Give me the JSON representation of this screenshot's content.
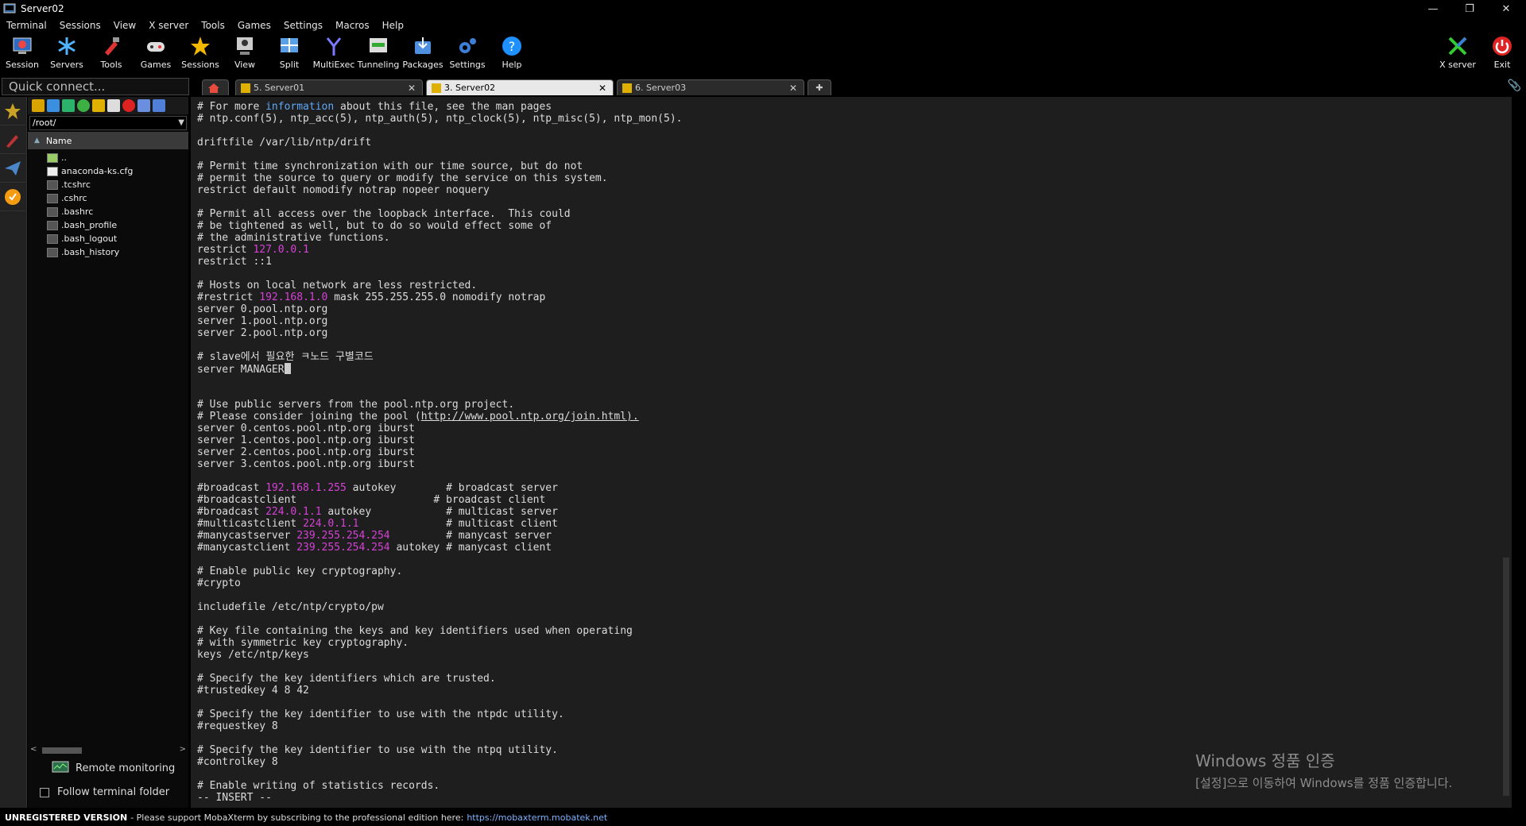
{
  "window": {
    "title": "Server02"
  },
  "menu": [
    "Terminal",
    "Sessions",
    "View",
    "X server",
    "Tools",
    "Games",
    "Settings",
    "Macros",
    "Help"
  ],
  "toolbar": {
    "session": "Session",
    "servers": "Servers",
    "tools": "Tools",
    "games": "Games",
    "sessions": "Sessions",
    "view": "View",
    "split": "Split",
    "multiexec": "MultiExec",
    "tunneling": "Tunneling",
    "packages": "Packages",
    "settings": "Settings",
    "help": "Help",
    "xserver": "X server",
    "exit": "Exit"
  },
  "quick_connect": {
    "placeholder": "Quick connect..."
  },
  "sidebar": {
    "path": "/root/",
    "column_header": "Name",
    "files": [
      "..",
      "anaconda-ks.cfg",
      ".tcshrc",
      ".cshrc",
      ".bashrc",
      ".bash_profile",
      ".bash_logout",
      ".bash_history"
    ],
    "remote_monitoring": "Remote monitoring",
    "follow_terminal_folder": "Follow terminal folder"
  },
  "tabs": [
    {
      "label": "5. Server01",
      "active": false
    },
    {
      "label": "3. Server02",
      "active": true
    },
    {
      "label": "6. Server03",
      "active": false
    }
  ],
  "terminal": {
    "lines": [
      [
        {
          "t": "# For more "
        },
        {
          "t": "information",
          "c": "bl"
        },
        {
          "t": " about this file, see the man pages"
        }
      ],
      [
        {
          "t": "# ntp.conf(5), ntp_acc(5), ntp_auth(5), ntp_clock(5), ntp_misc(5), ntp_mon(5)."
        }
      ],
      [
        {
          "t": ""
        }
      ],
      [
        {
          "t": "driftfile /var/lib/ntp/drift"
        }
      ],
      [
        {
          "t": ""
        }
      ],
      [
        {
          "t": "# Permit time synchronization with our time source, but do not"
        }
      ],
      [
        {
          "t": "# permit the source to query or modify the service on this system."
        }
      ],
      [
        {
          "t": "restrict default nomodify notrap nopeer noquery"
        }
      ],
      [
        {
          "t": ""
        }
      ],
      [
        {
          "t": "# Permit all access over the loopback interface.  This could"
        }
      ],
      [
        {
          "t": "# be tightened as well, but to do so would effect some of"
        }
      ],
      [
        {
          "t": "# the administrative functions."
        }
      ],
      [
        {
          "t": "restrict "
        },
        {
          "t": "127.0.0.1",
          "c": "mg"
        }
      ],
      [
        {
          "t": "restrict ::1"
        }
      ],
      [
        {
          "t": ""
        }
      ],
      [
        {
          "t": "# Hosts on local network are less restricted."
        }
      ],
      [
        {
          "t": "#restrict "
        },
        {
          "t": "192.168.1.0",
          "c": "mg"
        },
        {
          "t": " mask 255.255.255.0 nomodify notrap"
        }
      ],
      [
        {
          "t": "server 0.pool.ntp.org"
        }
      ],
      [
        {
          "t": "server 1.pool.ntp.org"
        }
      ],
      [
        {
          "t": "server 2.pool.ntp.org"
        }
      ],
      [
        {
          "t": ""
        }
      ],
      [
        {
          "t": "# slave에서 필요한 ㅋ노드 구별코드"
        }
      ],
      [
        {
          "t": "server MANAGER"
        },
        {
          "cursor": true
        }
      ],
      [
        {
          "t": ""
        }
      ],
      [
        {
          "t": ""
        }
      ],
      [
        {
          "t": "# Use public servers from the pool.ntp.org project."
        }
      ],
      [
        {
          "t": "# Please consider joining the pool ("
        },
        {
          "t": "http://www.pool.ntp.org/join.html).",
          "c": "ul"
        }
      ],
      [
        {
          "t": "server 0.centos.pool.ntp.org iburst"
        }
      ],
      [
        {
          "t": "server 1.centos.pool.ntp.org iburst"
        }
      ],
      [
        {
          "t": "server 2.centos.pool.ntp.org iburst"
        }
      ],
      [
        {
          "t": "server 3.centos.pool.ntp.org iburst"
        }
      ],
      [
        {
          "t": ""
        }
      ],
      [
        {
          "t": "#broadcast "
        },
        {
          "t": "192.168.1.255",
          "c": "mg"
        },
        {
          "t": " autokey        # broadcast server"
        }
      ],
      [
        {
          "t": "#broadcastclient                      # broadcast client"
        }
      ],
      [
        {
          "t": "#broadcast "
        },
        {
          "t": "224.0.1.1",
          "c": "mg"
        },
        {
          "t": " autokey            # multicast server"
        }
      ],
      [
        {
          "t": "#multicastclient "
        },
        {
          "t": "224.0.1.1",
          "c": "mg"
        },
        {
          "t": "              # multicast client"
        }
      ],
      [
        {
          "t": "#manycastserver "
        },
        {
          "t": "239.255.254.254",
          "c": "mg"
        },
        {
          "t": "         # manycast server"
        }
      ],
      [
        {
          "t": "#manycastclient "
        },
        {
          "t": "239.255.254.254",
          "c": "mg"
        },
        {
          "t": " autokey # manycast client"
        }
      ],
      [
        {
          "t": ""
        }
      ],
      [
        {
          "t": "# Enable public key cryptography."
        }
      ],
      [
        {
          "t": "#crypto"
        }
      ],
      [
        {
          "t": ""
        }
      ],
      [
        {
          "t": "includefile /etc/ntp/crypto/pw"
        }
      ],
      [
        {
          "t": ""
        }
      ],
      [
        {
          "t": "# Key file containing the keys and key identifiers used when operating"
        }
      ],
      [
        {
          "t": "# with symmetric key cryptography."
        }
      ],
      [
        {
          "t": "keys /etc/ntp/keys"
        }
      ],
      [
        {
          "t": ""
        }
      ],
      [
        {
          "t": "# Specify the key identifiers which are trusted."
        }
      ],
      [
        {
          "t": "#trustedkey 4 8 42"
        }
      ],
      [
        {
          "t": ""
        }
      ],
      [
        {
          "t": "# Specify the key identifier to use with the ntpdc utility."
        }
      ],
      [
        {
          "t": "#requestkey 8"
        }
      ],
      [
        {
          "t": ""
        }
      ],
      [
        {
          "t": "# Specify the key identifier to use with the ntpq utility."
        }
      ],
      [
        {
          "t": "#controlkey 8"
        }
      ],
      [
        {
          "t": ""
        }
      ],
      [
        {
          "t": "# Enable writing of statistics records."
        }
      ],
      [
        {
          "t": "-- INSERT --"
        }
      ]
    ]
  },
  "watermark": {
    "line1": "Windows 정품 인증",
    "line2": "[설정]으로 이동하여 Windows를 정품 인증합니다."
  },
  "status": {
    "label": "UNREGISTERED VERSION",
    "message": "-  Please support MobaXterm by subscribing to the professional edition here:",
    "link": "https://mobaxterm.mobatek.net"
  }
}
